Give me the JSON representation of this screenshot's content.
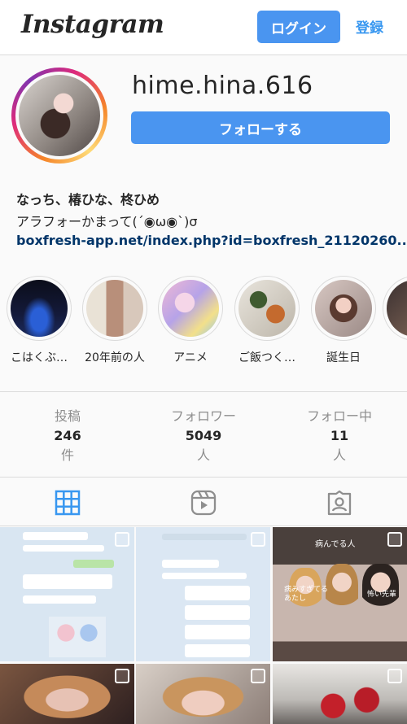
{
  "header": {
    "logo": "Instagram",
    "login_label": "ログイン",
    "register_label": "登録"
  },
  "profile": {
    "username": "hime.hina.616",
    "follow_label": "フォローする",
    "display_name": "なっち、椿ひな、柊ひめ",
    "bio": "アラフォーかまって(´◉ω◉`)σ",
    "link": "boxfresh-app.net/index.php?id=boxfresh_21120260..."
  },
  "highlights": [
    {
      "label": "こはくぶ…"
    },
    {
      "label": "20年前の人"
    },
    {
      "label": "アニメ"
    },
    {
      "label": "ご飯つく…"
    },
    {
      "label": "誕生日"
    },
    {
      "label": ""
    }
  ],
  "stats": [
    {
      "label": "投稿",
      "value": "246",
      "unit": "件"
    },
    {
      "label": "フォロワー",
      "value": "5049",
      "unit": "人"
    },
    {
      "label": "フォロー中",
      "value": "11",
      "unit": "人"
    }
  ],
  "tabs": [
    {
      "icon": "grid-icon",
      "active": true
    },
    {
      "icon": "reels-icon",
      "active": false
    },
    {
      "icon": "tagged-icon",
      "active": false
    }
  ],
  "posts": [
    {
      "type": "chat-screenshot"
    },
    {
      "type": "chat-screenshot"
    },
    {
      "type": "group-photo",
      "caption_1": "病んでる人",
      "caption_2": "怖い先輩",
      "caption_3": "病みすぎてる\nあたし"
    },
    {
      "type": "portrait"
    },
    {
      "type": "portrait"
    },
    {
      "type": "interior"
    }
  ],
  "colors": {
    "accent": "#4a95f0",
    "link": "#003569",
    "border": "#dbdbdb",
    "muted": "#8e8e8e"
  }
}
